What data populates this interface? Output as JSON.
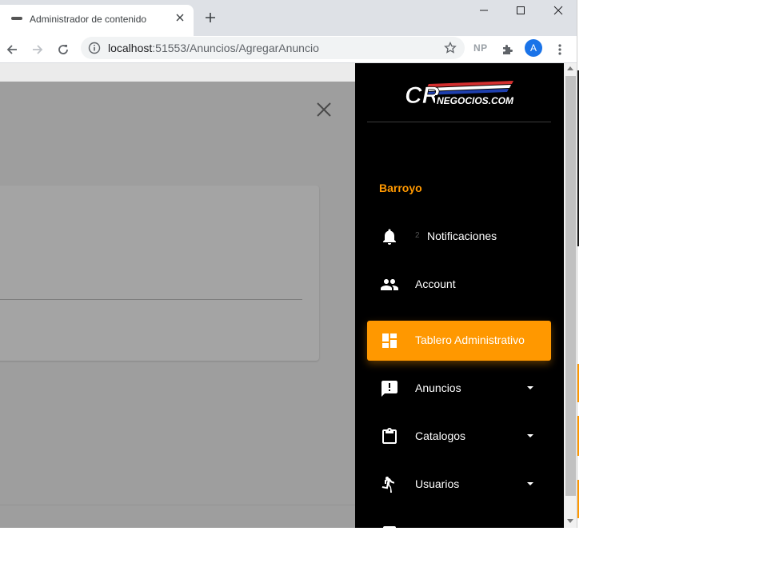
{
  "browser": {
    "tab_title": "Administrador de contenido",
    "url_host": "localhost",
    "url_rest": ":51553/Anuncios/AgregarAnuncio",
    "extension_label": "NP",
    "profile_initial": "A"
  },
  "sidebar": {
    "logo_text": "CRNEGOCIOS.COM",
    "user_name": "Barroyo",
    "notifications": {
      "count": "2",
      "label": "Notificaciones",
      "icon": "bell-icon"
    },
    "items": [
      {
        "label": "Account",
        "icon": "people-icon",
        "active": false,
        "has_submenu": false
      },
      {
        "label": "Tablero Administrativo",
        "icon": "dashboard-icon",
        "active": true,
        "has_submenu": false
      },
      {
        "label": "Anuncios",
        "icon": "announcement-icon",
        "active": false,
        "has_submenu": true
      },
      {
        "label": "Catalogos",
        "icon": "clipboard-icon",
        "active": false,
        "has_submenu": true
      },
      {
        "label": "Usuarios",
        "icon": "person-walking-icon",
        "active": false,
        "has_submenu": true
      }
    ]
  },
  "colors": {
    "accent": "#ff9800",
    "sidebar_bg": "#000000",
    "overlay_bg": "#9e9e9e",
    "tabstrip_bg": "#dee1e6"
  }
}
